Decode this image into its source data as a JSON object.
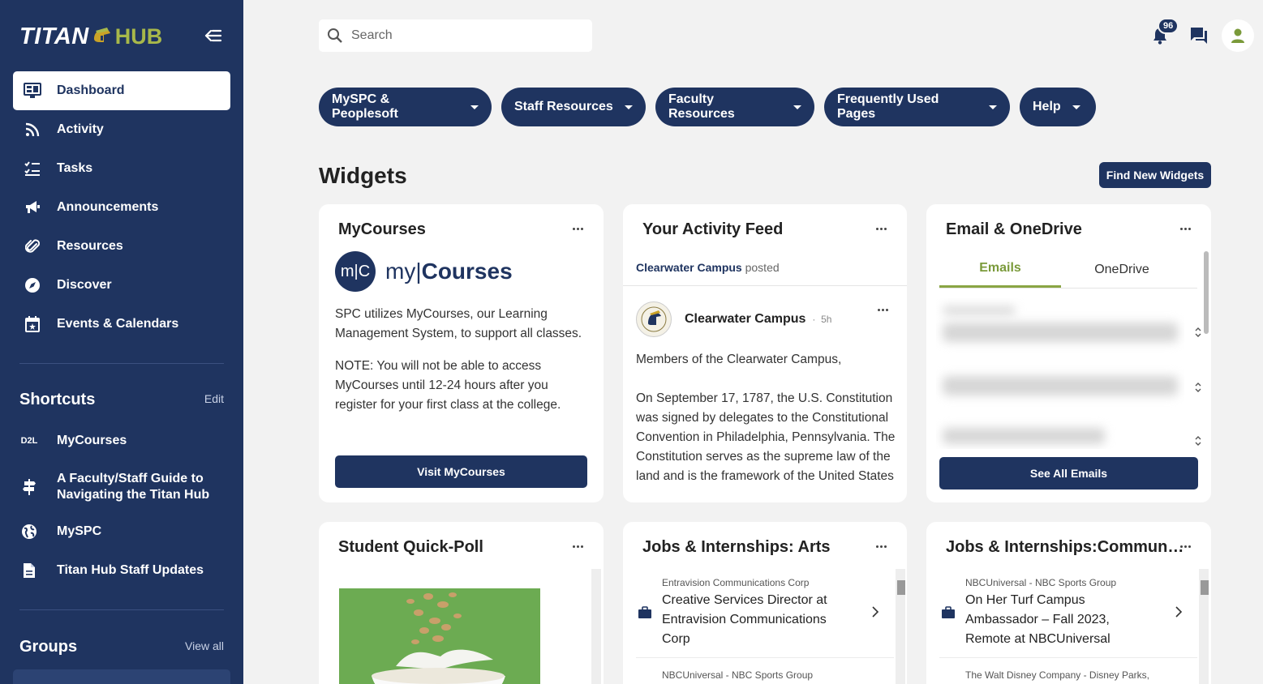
{
  "brand": {
    "titan": "TITAN",
    "hub": "HUB"
  },
  "sidebar": {
    "nav": [
      {
        "label": "Dashboard",
        "icon": "dashboard-icon"
      },
      {
        "label": "Activity",
        "icon": "rss-icon"
      },
      {
        "label": "Tasks",
        "icon": "checklist-icon"
      },
      {
        "label": "Announcements",
        "icon": "megaphone-icon"
      },
      {
        "label": "Resources",
        "icon": "paperclip-icon"
      },
      {
        "label": "Discover",
        "icon": "compass-icon"
      },
      {
        "label": "Events & Calendars",
        "icon": "calendar-icon"
      }
    ],
    "shortcuts_title": "Shortcuts",
    "shortcuts_edit": "Edit",
    "shortcuts": [
      {
        "label": "MyCourses",
        "icon": "d2l-icon",
        "icon_text": "D2L"
      },
      {
        "label": "A Faculty/Staff Guide to Navigating the Titan Hub",
        "icon": "signpost-icon"
      },
      {
        "label": "MySPC",
        "icon": "globe-icon"
      },
      {
        "label": "Titan Hub Staff Updates",
        "icon": "document-icon"
      }
    ],
    "groups_title": "Groups",
    "groups_view_all": "View all"
  },
  "search": {
    "placeholder": "Search"
  },
  "notifications": {
    "count": "96"
  },
  "menus": [
    {
      "label": "MySPC & Peoplesoft"
    },
    {
      "label": "Staff Resources"
    },
    {
      "label": "Faculty Resources"
    },
    {
      "label": "Frequently Used Pages"
    },
    {
      "label": "Help"
    }
  ],
  "widgets": {
    "title": "Widgets",
    "find_button": "Find New Widgets",
    "mycourses": {
      "title": "MyCourses",
      "logo_mark": "m|C",
      "logo_my": "my",
      "logo_courses": "Courses",
      "para1": "SPC utilizes MyCourses, our Learning Management System, to support all classes.",
      "note_label": "NOTE:",
      "note_text": " You will not be able to access MyCourses until 12-24 hours after you register for your first class at the college.",
      "button": "Visit MyCourses"
    },
    "activity": {
      "title": "Your Activity Feed",
      "header_author": "Clearwater Campus",
      "header_action": "posted",
      "author": "Clearwater Campus",
      "time": "5h",
      "line1": "Members of the Clearwater Campus,",
      "body": "On September 17, 1787, the U.S. Constitution was signed by delegates to the Constitutional Convention in Philadelphia, Pennsylvania. The Constitution serves as the supreme law of the land and is the framework of the United States"
    },
    "email": {
      "title": "Email & OneDrive",
      "tab_emails": "Emails",
      "tab_onedrive": "OneDrive",
      "button": "See All Emails"
    },
    "poll": {
      "title": "Student Quick-Poll"
    },
    "jobs_arts": {
      "title": "Jobs & Internships: Arts",
      "items": [
        {
          "company": "Entravision Communications Corp",
          "title": "Creative Services Director at Entravision Communications Corp"
        },
        {
          "company": "NBCUniversal - NBC Sports Group",
          "title": ""
        }
      ]
    },
    "jobs_comm": {
      "title": "Jobs & Internships:Commun…",
      "items": [
        {
          "company": "NBCUniversal - NBC Sports Group",
          "title": "On Her Turf Campus Ambassador – Fall 2023, Remote at NBCUniversal"
        },
        {
          "company": "The Walt Disney Company - Disney Parks,",
          "title": ""
        }
      ]
    }
  },
  "colors": {
    "primary": "#1f3460",
    "accent": "#8aa544",
    "background": "#f2f2f2"
  }
}
